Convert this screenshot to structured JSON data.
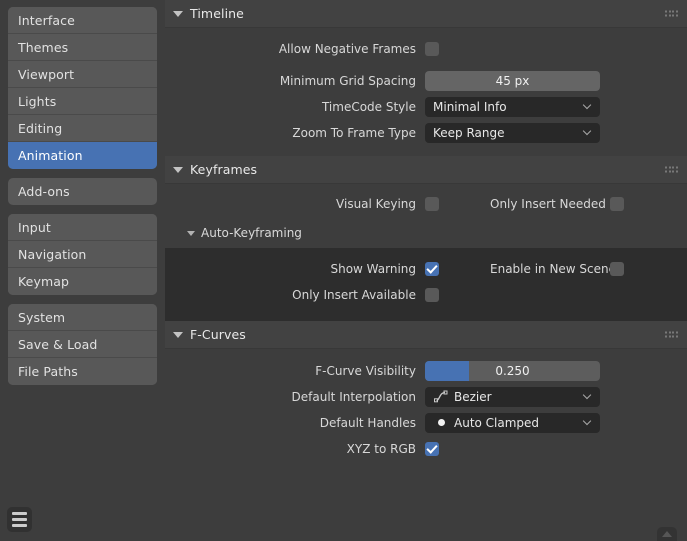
{
  "sidebar": {
    "groups": [
      {
        "items": [
          {
            "label": "Interface",
            "selected": false
          },
          {
            "label": "Themes",
            "selected": false
          },
          {
            "label": "Viewport",
            "selected": false
          },
          {
            "label": "Lights",
            "selected": false
          },
          {
            "label": "Editing",
            "selected": false
          },
          {
            "label": "Animation",
            "selected": true
          }
        ]
      },
      {
        "items": [
          {
            "label": "Add-ons",
            "selected": false
          }
        ]
      },
      {
        "items": [
          {
            "label": "Input",
            "selected": false
          },
          {
            "label": "Navigation",
            "selected": false
          },
          {
            "label": "Keymap",
            "selected": false
          }
        ]
      },
      {
        "items": [
          {
            "label": "System",
            "selected": false
          },
          {
            "label": "Save & Load",
            "selected": false
          },
          {
            "label": "File Paths",
            "selected": false
          }
        ]
      }
    ],
    "menu_button": "hamburger-menu"
  },
  "panels": {
    "timeline": {
      "title": "Timeline",
      "expanded": true,
      "allow_negative_frames": {
        "label": "Allow Negative Frames",
        "checked": false
      },
      "minimum_grid_spacing": {
        "label": "Minimum Grid Spacing",
        "value": "45 px"
      },
      "timecode_style": {
        "label": "TimeCode Style",
        "value": "Minimal Info"
      },
      "zoom_to_frame_type": {
        "label": "Zoom To Frame Type",
        "value": "Keep Range"
      }
    },
    "keyframes": {
      "title": "Keyframes",
      "expanded": true,
      "visual_keying": {
        "label": "Visual Keying",
        "checked": false
      },
      "only_insert_needed": {
        "label": "Only Insert Needed",
        "checked": false
      },
      "auto_keyframing": {
        "title": "Auto-Keyframing",
        "expanded": true,
        "show_warning": {
          "label": "Show Warning",
          "checked": true
        },
        "enable_in_new_scenes": {
          "label": "Enable in New Scenes",
          "checked": false
        },
        "only_insert_available": {
          "label": "Only Insert Available",
          "checked": false
        }
      }
    },
    "fcurves": {
      "title": "F-Curves",
      "expanded": true,
      "fcurve_visibility": {
        "label": "F-Curve Visibility",
        "value": "0.250",
        "fill_percent": 25
      },
      "default_interpolation": {
        "label": "Default Interpolation",
        "value": "Bezier",
        "icon": "bezier-curve-icon"
      },
      "default_handles": {
        "label": "Default Handles",
        "value": "Auto Clamped",
        "icon": "handle-dot-icon"
      },
      "xyz_to_rgb": {
        "label": "XYZ to RGB",
        "checked": true
      }
    }
  },
  "colors": {
    "accent": "#4772b3",
    "window_bg": "#3d3d3d",
    "panel_header_bg": "#424242",
    "panel_dark_bg": "#2d2d2d",
    "nav_item_bg": "#585858",
    "dropdown_bg": "#282828",
    "field_bg": "#656565"
  }
}
